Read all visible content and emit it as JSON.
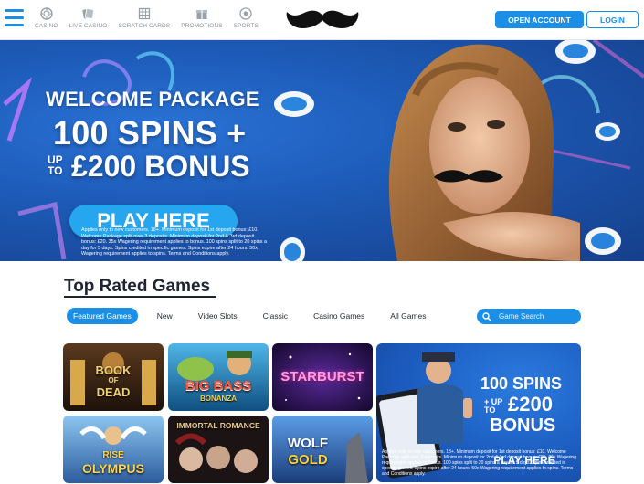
{
  "header": {
    "nav": [
      {
        "label": "CASINO",
        "icon": "casino-chip-icon"
      },
      {
        "label": "LIVE CASINO",
        "icon": "live-casino-icon"
      },
      {
        "label": "SCRATCH CARDS",
        "icon": "scratch-cards-icon"
      },
      {
        "label": "PROMOTIONS",
        "icon": "promotions-icon"
      },
      {
        "label": "SPORTS",
        "icon": "sports-ball-icon"
      }
    ],
    "logo": "mustache-logo",
    "open_account": "OPEN ACCOUNT",
    "login": "LOGIN"
  },
  "hero": {
    "title1": "WELCOME PACKAGE",
    "title2": "100 SPINS +",
    "upto_line1": "UP",
    "upto_line2": "TO",
    "title3": "£200 BONUS",
    "cta": "PLAY HERE",
    "terms": "Applies only to new customers. 18+. Minimum deposit for 1st deposit bonus: £10. Welcome Package split over 3 deposits. Minimum deposit for 2nd & 3rd deposit bonus: £20. 35x Wagering requirement applies to bonus. 100 spins split to 20 spins a day for 5 days. Spins credited in specific games. Spins expire after 24 hours. 50x Wagering requirement applies to spins. Terms and Conditions apply."
  },
  "top_rated": {
    "title": "Top Rated Games",
    "tabs": [
      {
        "label": "Featured Games",
        "active": true
      },
      {
        "label": "New",
        "active": false
      },
      {
        "label": "Video Slots",
        "active": false
      },
      {
        "label": "Classic",
        "active": false
      },
      {
        "label": "Casino Games",
        "active": false
      },
      {
        "label": "All Games",
        "active": false
      }
    ],
    "search_placeholder": "Game Search"
  },
  "games": [
    {
      "title": "BOOK OF DEAD",
      "line1": "BOOK",
      "line2": "OF",
      "line3": "DEAD"
    },
    {
      "title": "BIG BASS BONANZA",
      "line1": "BIG BASS",
      "line2": "BONANZA"
    },
    {
      "title": "STARBURST",
      "line1": "STARBURST"
    },
    {
      "title": "RISE OF OLYMPUS",
      "line1": "RISE",
      "line2": "OLYMPUS"
    },
    {
      "title": "IMMORTAL ROMANCE",
      "line1": "IMMORTAL ROMANCE"
    },
    {
      "title": "WOLF GOLD",
      "line1": "WOLF",
      "line2": "GOLD"
    }
  ],
  "promo_tile": {
    "line1": "100 SPINS",
    "upto_line1": "+ UP",
    "upto_line2": "TO",
    "line2": "£200",
    "line3": "BONUS",
    "terms": "Applies only to new customers. 18+. Minimum deposit for 1st deposit bonus: £10. Welcome Package split over 3 deposits. Minimum deposit for 2nd & 3rd deposit bonus: £20. 35x Wagering requirement applies to bonus. 100 spins split to 20 spins a day for 5 days. Spins credited in specific games. Spins expire after 24 hours. 50x Wagering requirement applies to spins. Terms and Conditions apply.",
    "cta": "PLAY HERE"
  },
  "colors": {
    "brand_blue": "#1b8fe6",
    "hero_blue": "#1d5bb8",
    "text_dark": "#1f2433"
  }
}
